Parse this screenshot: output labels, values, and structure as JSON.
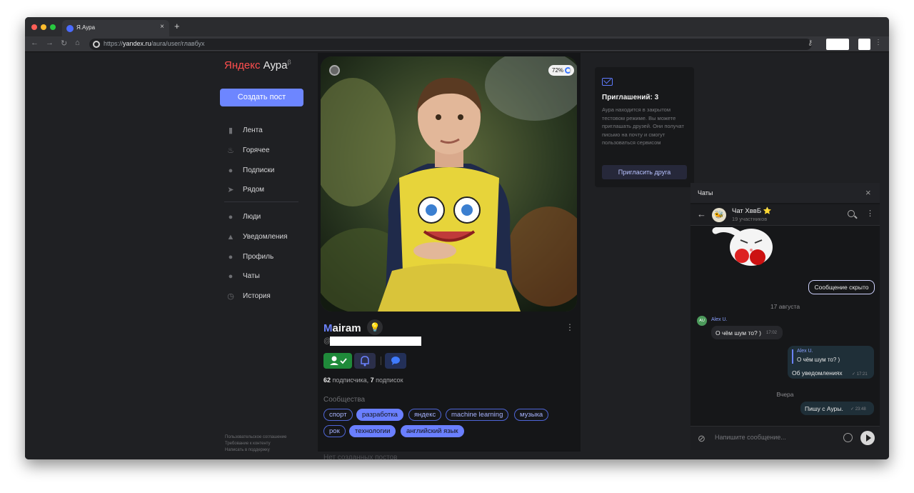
{
  "browser": {
    "tab_title": "Я.Аура",
    "tab_close": "×",
    "new_tab": "+",
    "url_prefix": "https://",
    "url_domain": "yandex.ru",
    "url_path": "/aura/user/главбух"
  },
  "sidebar": {
    "logo_brand": "Яндекс",
    "logo_product": " Аура",
    "logo_beta": "β",
    "create_post": "Создать пост",
    "items": [
      {
        "label": "Лента",
        "icon": "feed-icon"
      },
      {
        "label": "Горячее",
        "icon": "fire-icon"
      },
      {
        "label": "Подписки",
        "icon": "person-icon"
      },
      {
        "label": "Рядом",
        "icon": "location-arrow-icon"
      },
      {
        "label": "Люди",
        "icon": "people-icon"
      },
      {
        "label": "Уведомления",
        "icon": "bell-icon"
      },
      {
        "label": "Профиль",
        "icon": "person-icon"
      },
      {
        "label": "Чаты",
        "icon": "chat-icon"
      },
      {
        "label": "История",
        "icon": "history-icon"
      }
    ],
    "footer": [
      "Пользовательское соглашение",
      "Требование к контенту",
      "Написать в поддержку"
    ]
  },
  "profile": {
    "photo_progress": "72%",
    "name_first_letter": "M",
    "name_rest": "airam",
    "handle_prefix": "@",
    "followers_count": "62",
    "followers_label": " подписчика, ",
    "following_count": "7",
    "following_label": " подписок",
    "communities_title": "Сообщества",
    "communities": [
      {
        "name": "спорт",
        "active": false
      },
      {
        "name": "разработка",
        "active": true
      },
      {
        "name": "яндекс",
        "active": false
      },
      {
        "name": "machine learning",
        "active": false
      },
      {
        "name": "музыка",
        "active": false
      },
      {
        "name": "рок",
        "active": false
      },
      {
        "name": "технологии",
        "active": true
      },
      {
        "name": "английский язык",
        "active": true
      }
    ],
    "no_posts": "Нет созданных постов"
  },
  "invite": {
    "title": "Приглашений: 3",
    "text": "Аура находится в закрытом тестовом режиме. Вы можете приглашать друзей. Они получат письмо на почту и смогут пользоваться сервисом",
    "button": "Пригласить друга"
  },
  "chat": {
    "panel_title": "Чаты",
    "close": "×",
    "conversation_name": "Чат ХввБ ⭐",
    "members": "19 участников",
    "hidden_message": "Сообщение скрыто",
    "date_1": "17 августа",
    "sender_initials": "AU",
    "sender_name": "Alex U.",
    "msg_1_text": "О чём шум то? )",
    "msg_1_time": "17:02",
    "reply_name": "Alex U.",
    "reply_quote": "О чём шум то? )",
    "msg_2_text": "Об уведомлениях",
    "msg_2_time": "✓ 17:21",
    "date_2": "Вчера",
    "msg_3_text": "Пишу с Ауры.",
    "msg_3_time": "✓ 23:48",
    "input_placeholder": "Напишите сообщение..."
  },
  "colors": {
    "accent": "#6d86ff",
    "follow_green": "#1f8a3a",
    "logo_red": "#ff4e4e"
  }
}
